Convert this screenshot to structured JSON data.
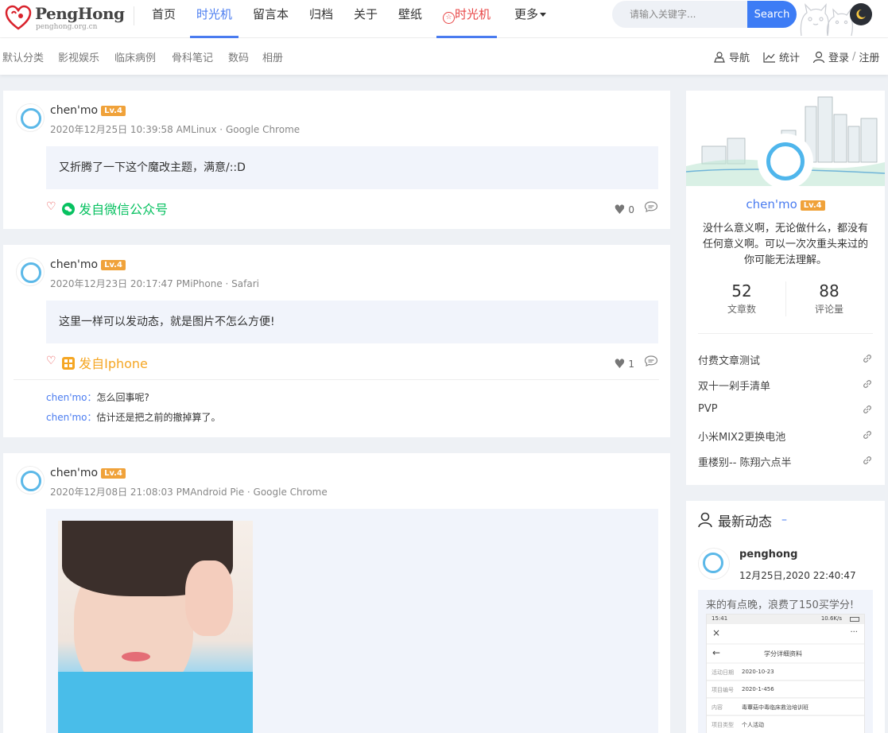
{
  "brand": {
    "title": "PengHong",
    "subtitle": "penghong.org.cn"
  },
  "nav": {
    "items": [
      {
        "label": "首页"
      },
      {
        "label": "时光机"
      },
      {
        "label": "留言本"
      },
      {
        "label": "归档"
      },
      {
        "label": "关于"
      },
      {
        "label": "壁纸"
      },
      {
        "label": "时光机"
      },
      {
        "label": "更多"
      }
    ]
  },
  "search": {
    "placeholder": "请输入关键字...",
    "button": "Search"
  },
  "subnav": {
    "categories": [
      "默认分类",
      "影视娱乐",
      "临床病例",
      "骨科笔记",
      "数码",
      "相册"
    ],
    "right": {
      "nav": "导航",
      "stats": "统计",
      "login": "登录",
      "sep": "/",
      "register": "注册"
    }
  },
  "posts": [
    {
      "author": "chen'mo",
      "level": "Lv.4",
      "meta": "2020年12月25日 10:39:58 AMLinux · Google Chrome",
      "content": "又折腾了一下这个魔改主题，满意/::D",
      "source": "发自微信公众号",
      "likes": "0",
      "comments": []
    },
    {
      "author": "chen'mo",
      "level": "Lv.4",
      "meta": "2020年12月23日 20:17:47 PMiPhone · Safari",
      "content": "这里一样可以发动态，就是图片不怎么方便!",
      "source": "发自Iphone",
      "likes": "1",
      "comments": [
        {
          "who": "chen'mo",
          "sep": "：",
          "text": "怎么回事呢?"
        },
        {
          "who": "chen'mo",
          "sep": "：",
          "text": "估计还是把之前的撤掉算了。"
        }
      ]
    },
    {
      "author": "chen'mo",
      "level": "Lv.4",
      "meta": "2020年12月08日 21:08:03 PMAndroid Pie · Google Chrome"
    }
  ],
  "profile": {
    "name": "chen'mo",
    "level": "Lv.4",
    "bio": "没什么意义啊，无论做什么，都没有任何意义啊。可以一次次重头来过的你可能无法理解。",
    "stats": [
      {
        "value": "52",
        "label": "文章数"
      },
      {
        "value": "88",
        "label": "评论量"
      }
    ],
    "links": [
      "付费文章测试",
      "双十一剁手清单",
      "PVP",
      "小米MIX2更换电池",
      "重楼别-- 陈翔六点半"
    ]
  },
  "latest": {
    "title": "最新动态",
    "dash": "–",
    "user": "penghong",
    "time": "12月25日,2020 22:40:47",
    "text": "来的有点晚，浪费了150买学分!",
    "phone": {
      "time": "15:41",
      "status": "10.6K/s",
      "close": "×",
      "more": "···",
      "back": "←",
      "title": "学分详细资料",
      "rows": [
        {
          "k": "活动日期",
          "v": "2020-10-23"
        },
        {
          "k": "项目编号",
          "v": "2020-1-456"
        },
        {
          "k": "内容",
          "v": "毒蕈菇中毒临床救治培训班"
        },
        {
          "k": "项目类型",
          "v": "个人活动"
        }
      ]
    }
  },
  "colors": {
    "accent": "#4a7cf0",
    "wechat": "#07c160",
    "iphone": "#f5a623",
    "badge": "#f0a23a",
    "red": "#e84545"
  }
}
